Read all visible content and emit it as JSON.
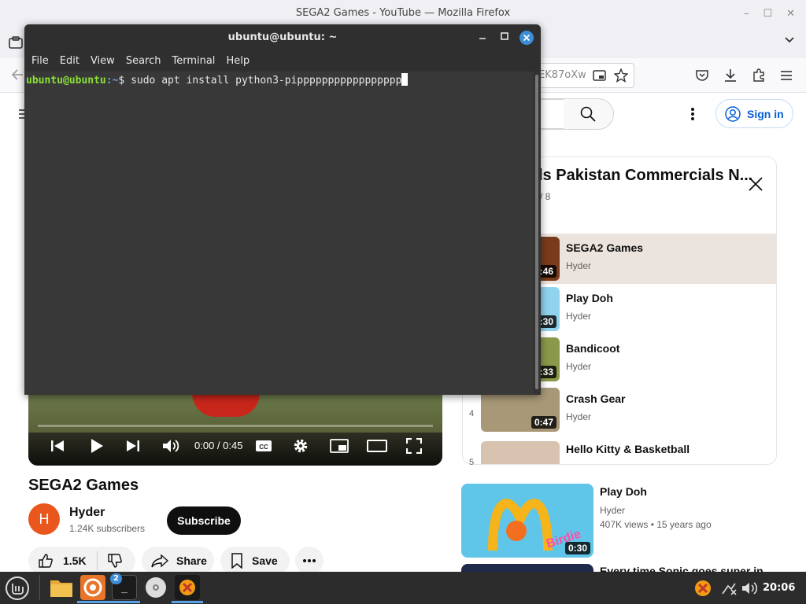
{
  "firefox": {
    "window_title": "SEGA2 Games - YouTube — Mozilla Firefox",
    "url_fragment": "EK87oXw"
  },
  "youtube": {
    "sign_in": "Sign in",
    "playlist": {
      "title": "ls Pakistan Commercials N...",
      "count": "/ 8",
      "items": [
        {
          "index": "",
          "title": "SEGA2 Games",
          "channel": "Hyder",
          "duration": ":46",
          "active": true
        },
        {
          "index": "",
          "title": "Play Doh",
          "channel": "Hyder",
          "duration": ":30",
          "active": false
        },
        {
          "index": "",
          "title": "Bandicoot",
          "channel": "Hyder",
          "duration": ":33",
          "active": false
        },
        {
          "index": "4",
          "title": "Crash Gear",
          "channel": "Hyder",
          "duration": "0:47",
          "active": false
        },
        {
          "index": "5",
          "title": "Hello Kitty & Basketball",
          "channel": "",
          "duration": "",
          "active": false
        }
      ]
    },
    "player": {
      "time": "0:00 / 0:45",
      "progress": 0
    },
    "video": {
      "title": "SEGA2 Games",
      "channel": "Hyder",
      "channel_initial": "H",
      "subscribers": "1.24K subscribers",
      "subscribe": "Subscribe",
      "likes": "1.5K",
      "share": "Share",
      "save": "Save"
    },
    "recommended": [
      {
        "title": "Play Doh",
        "channel": "Hyder",
        "meta": "407K views • 15 years ago",
        "duration": "0:30",
        "thumb_text": "Birdie"
      },
      {
        "title": "Every time Sonic goes super in",
        "channel": "",
        "meta": "",
        "duration": ""
      }
    ]
  },
  "terminal": {
    "title": "ubuntu@ubuntu: ~",
    "menu": [
      "File",
      "Edit",
      "View",
      "Search",
      "Terminal",
      "Help"
    ],
    "prompt_user": "ubuntu@ubuntu",
    "prompt_path": ":~",
    "prompt_symbol": "$ ",
    "command": "sudo apt install python3-pippppppppppppppppp"
  },
  "taskbar": {
    "terminal_badge": "2",
    "clock": "20:06"
  },
  "colors": {
    "accent_blue": "#065fd4",
    "terminal_bg": "#383838",
    "prompt_green": "#8ae234",
    "prompt_blue": "#729fcf"
  }
}
